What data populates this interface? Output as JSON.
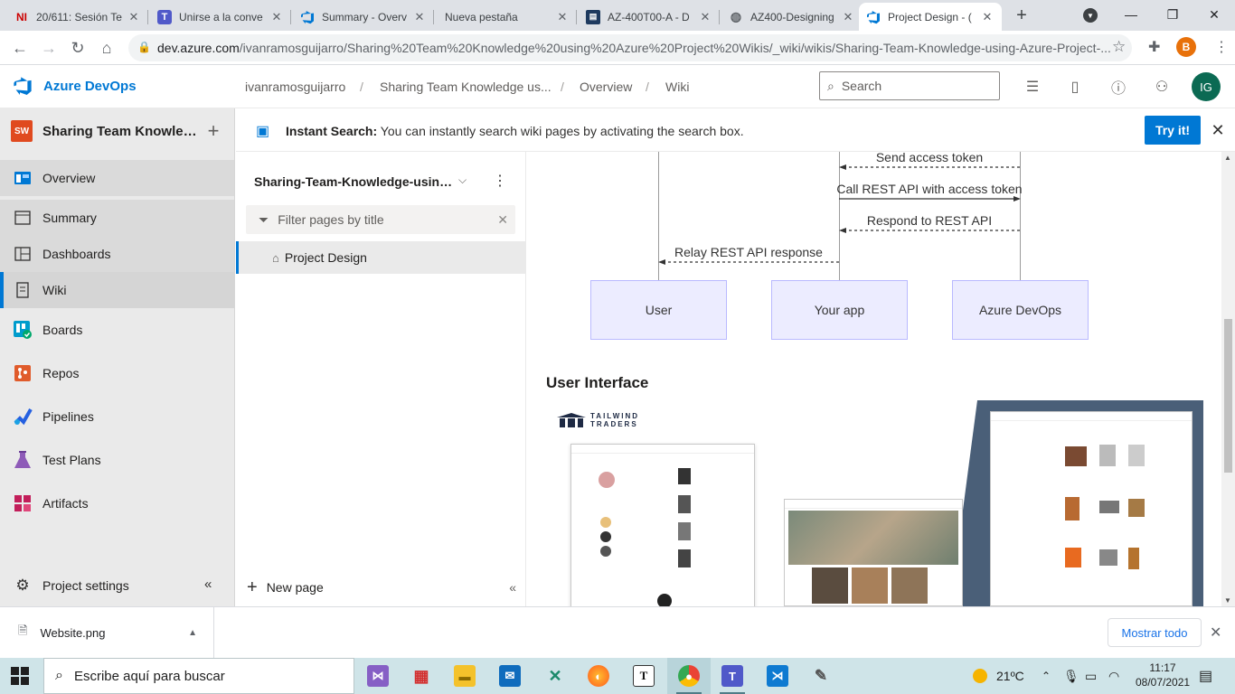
{
  "browser": {
    "tabs": [
      {
        "label": "20/611: Sesión Te",
        "icon": "ni-icon",
        "active": false
      },
      {
        "label": "Unirse a la conve",
        "icon": "teams-icon",
        "active": false
      },
      {
        "label": "Summary - Overv",
        "icon": "azure-devops-icon",
        "active": false
      },
      {
        "label": "Nueva pestaña",
        "icon": "blank-icon",
        "active": false
      },
      {
        "label": "AZ-400T00-A - D",
        "icon": "book-icon",
        "active": false
      },
      {
        "label": "AZ400-Designing",
        "icon": "globe-icon",
        "active": false
      },
      {
        "label": "Project Design - (",
        "icon": "azure-devops-icon",
        "active": true
      }
    ],
    "url_host": "dev.azure.com",
    "url_path": "/ivanramosguijarro/Sharing%20Team%20Knowledge%20using%20Azure%20Project%20Wikis/_wiki/wikis/Sharing-Team-Knowledge-using-Azure-Project-...",
    "profile_initial": "B"
  },
  "header": {
    "brand": "Azure DevOps",
    "breadcrumbs": [
      "ivanramosguijarro",
      "Sharing Team Knowledge us...",
      "Overview",
      "Wiki"
    ],
    "search_placeholder": "Search",
    "user_initials": "IG"
  },
  "sidebar": {
    "project_badge": "SW",
    "project_name": "Sharing Team Knowled...",
    "items": [
      {
        "label": "Overview",
        "icon": "overview-icon"
      },
      {
        "label": "Summary",
        "icon": "summary-icon"
      },
      {
        "label": "Dashboards",
        "icon": "dashboards-icon"
      },
      {
        "label": "Wiki",
        "icon": "wiki-icon"
      },
      {
        "label": "Boards",
        "icon": "boards-icon"
      },
      {
        "label": "Repos",
        "icon": "repos-icon"
      },
      {
        "label": "Pipelines",
        "icon": "pipelines-icon"
      },
      {
        "label": "Test Plans",
        "icon": "test-plans-icon"
      },
      {
        "label": "Artifacts",
        "icon": "artifacts-icon"
      }
    ],
    "settings_label": "Project settings"
  },
  "banner": {
    "title": "Instant Search:",
    "text": "You can instantly search wiki pages by activating the search box.",
    "button": "Try it!"
  },
  "wiki": {
    "name": "Sharing-Team-Knowledge-using...",
    "filter_placeholder": "Filter pages by title",
    "pages": [
      "Project Design"
    ],
    "new_page": "New page"
  },
  "content": {
    "sequence_messages": [
      "Send access token",
      "Call REST API with access token",
      "Respond to REST API",
      "Relay REST API response"
    ],
    "actors": [
      "User",
      "Your app",
      "Azure DevOps"
    ],
    "section_title": "User Interface",
    "mockup_brand": "TAILWIND TRADERS"
  },
  "downloads": {
    "file": "Website.png",
    "show_all": "Mostrar todo"
  },
  "taskbar": {
    "search_placeholder": "Escribe aquí para buscar",
    "weather": "21ºC",
    "time": "11:17",
    "date": "08/07/2021"
  },
  "colors": {
    "accent": "#0078d4",
    "actor_fill": "#ececff",
    "actor_border": "#b9b9ff",
    "project_badge": "#e04a1f"
  }
}
